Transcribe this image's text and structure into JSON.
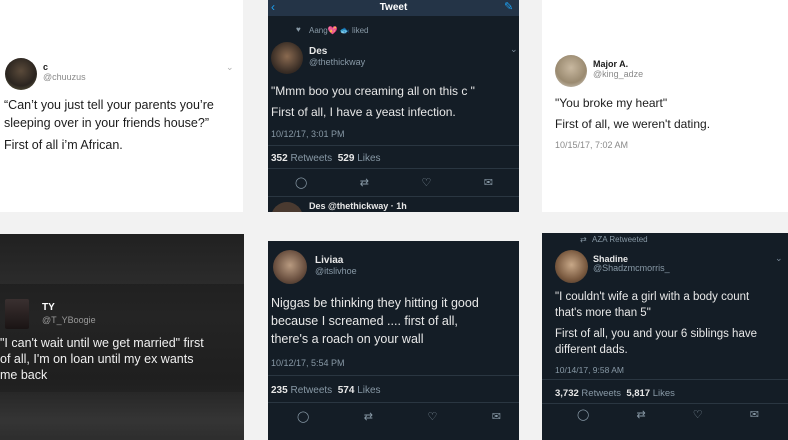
{
  "card1": {
    "name": "c",
    "handle": "@chuuzus",
    "line1": "“Can’t you just tell your parents you’re",
    "line2": "sleeping over in your friends house?”",
    "line3": "First of all i’m African."
  },
  "card2": {
    "header_title": "Tweet",
    "liked_text": "Aang💖 🐟 liked",
    "name": "Des",
    "handle": "@thethickway",
    "line1": "\"Mmm boo you creaming all on this c      \"",
    "line2": "First of all, I have a yeast infection.",
    "timestamp": "10/12/17, 3:01 PM",
    "retweets_count": "352",
    "retweets_label": "Retweets",
    "likes_count": "529",
    "likes_label": "Likes",
    "reply_preview": "Des @thethickway · 1h"
  },
  "card3": {
    "name": "Major A.",
    "handle": "@king_adze",
    "line1": "\"You broke my heart\"",
    "line2": "First of all, we weren't dating.",
    "timestamp": "10/15/17, 7:02 AM"
  },
  "card4": {
    "name": "TY",
    "handle": "@T_YBoogie",
    "line1": "\"I can't wait until we get married\" first",
    "line2": "of all, I'm on loan until my ex wants",
    "line3": "me back"
  },
  "card5": {
    "name": "Liviaa",
    "handle": "@itslivhoe",
    "line1": "Niggas be thinking they hitting it good",
    "line2": "because I screamed .... first of all,",
    "line3": "there's a roach on your wall",
    "timestamp": "10/12/17, 5:54 PM",
    "retweets_count": "235",
    "retweets_label": "Retweets",
    "likes_count": "574",
    "likes_label": "Likes"
  },
  "card6": {
    "retweeted_by": "AZA Retweeted",
    "name": "Shadine",
    "handle": "@Shadzmcmorris_",
    "line1": "\"I couldn't wife a girl with a body count",
    "line2": "that's more than 5\"",
    "line3": "First of all, you and your 6 siblings have",
    "line4": "different dads.",
    "timestamp": "10/14/17, 9:58 AM",
    "retweets_count": "3,732",
    "retweets_label": "Retweets",
    "likes_count": "5,817",
    "likes_label": "Likes"
  },
  "icons": {
    "reply": "reply-icon",
    "retweet": "retweet-icon",
    "like": "heart-icon",
    "message": "message-icon",
    "chevron": "chevron-down-icon",
    "back": "back-arrow-icon",
    "compose": "compose-icon"
  },
  "colors": {
    "dark_bg": "#141d26",
    "light_bg": "#ffffff",
    "accent": "#1da1f2",
    "muted": "#8899a6"
  }
}
